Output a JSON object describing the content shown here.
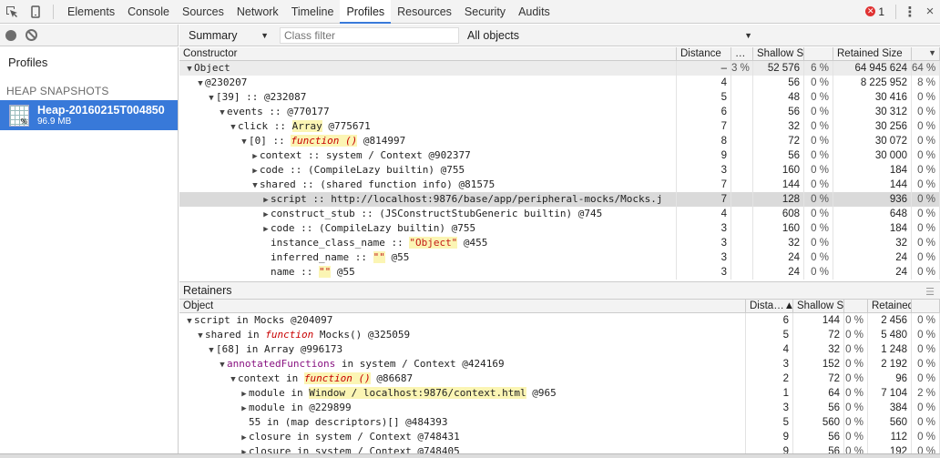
{
  "toolbar": {
    "tabs": [
      "Elements",
      "Console",
      "Sources",
      "Network",
      "Timeline",
      "Profiles",
      "Resources",
      "Security",
      "Audits"
    ],
    "active_tab": "Profiles",
    "error_count": "1",
    "kebab": "⋮",
    "close": "×"
  },
  "sidebar": {
    "title": "Profiles",
    "section": "HEAP SNAPSHOTS",
    "snapshot_name": "Heap-20160215T004850",
    "snapshot_size": "96.9 MB",
    "snapshot_badge": "%"
  },
  "filterbar": {
    "view": "Summary",
    "class_filter_placeholder": "Class filter",
    "objects": "All objects"
  },
  "constructor_grid": {
    "headers": [
      "Constructor",
      "Distance",
      "…",
      "Shallow Size",
      "",
      "Retained Size",
      ""
    ],
    "rows": [
      {
        "indent": 0,
        "tri": "▼",
        "parts": [
          {
            "t": "Object"
          }
        ],
        "dist": "–",
        "obj": "3 %",
        "shallow": "52 576",
        "spct": "6 %",
        "retained": "64 945 624",
        "rpct": "64 %",
        "group": true
      },
      {
        "indent": 1,
        "tri": "▼",
        "parts": [
          {
            "t": "@230207"
          }
        ],
        "dist": "4",
        "obj": "",
        "shallow": "56",
        "spct": "0 %",
        "retained": "8 225 952",
        "rpct": "8 %"
      },
      {
        "indent": 2,
        "tri": "▼",
        "parts": [
          {
            "t": "[39] :: @232087"
          }
        ],
        "dist": "5",
        "obj": "",
        "shallow": "48",
        "spct": "0 %",
        "retained": "30 416",
        "rpct": "0 %"
      },
      {
        "indent": 3,
        "tri": "▼",
        "parts": [
          {
            "t": "events :: @770177"
          }
        ],
        "dist": "6",
        "obj": "",
        "shallow": "56",
        "spct": "0 %",
        "retained": "30 312",
        "rpct": "0 %"
      },
      {
        "indent": 4,
        "tri": "▼",
        "parts": [
          {
            "t": "click :: "
          },
          {
            "t": "Array",
            "c": "hl"
          },
          {
            "t": " @775671"
          }
        ],
        "dist": "7",
        "obj": "",
        "shallow": "32",
        "spct": "0 %",
        "retained": "30 256",
        "rpct": "0 %"
      },
      {
        "indent": 5,
        "tri": "▼",
        "parts": [
          {
            "t": "[0] :: "
          },
          {
            "t": "function ()",
            "c": "hl fn"
          },
          {
            "t": " @814997"
          }
        ],
        "dist": "8",
        "obj": "",
        "shallow": "72",
        "spct": "0 %",
        "retained": "30 072",
        "rpct": "0 %"
      },
      {
        "indent": 6,
        "tri": "▶",
        "parts": [
          {
            "t": "context :: system / Context @902377"
          }
        ],
        "dist": "9",
        "obj": "",
        "shallow": "56",
        "spct": "0 %",
        "retained": "30 000",
        "rpct": "0 %"
      },
      {
        "indent": 6,
        "tri": "▶",
        "parts": [
          {
            "t": "code :: (CompileLazy builtin) @755"
          }
        ],
        "dist": "3",
        "obj": "",
        "shallow": "160",
        "spct": "0 %",
        "retained": "184",
        "rpct": "0 %"
      },
      {
        "indent": 6,
        "tri": "▼",
        "parts": [
          {
            "t": "shared :: (shared function info) @81575"
          }
        ],
        "dist": "7",
        "obj": "",
        "shallow": "144",
        "spct": "0 %",
        "retained": "144",
        "rpct": "0 %"
      },
      {
        "indent": 7,
        "tri": "▶",
        "parts": [
          {
            "t": "script :: http://localhost:9876/base/app/peripheral-mocks/Mocks.j"
          }
        ],
        "dist": "7",
        "obj": "",
        "shallow": "128",
        "spct": "0 %",
        "retained": "936",
        "rpct": "0 %",
        "selected": true
      },
      {
        "indent": 7,
        "tri": "▶",
        "parts": [
          {
            "t": "construct_stub :: (JSConstructStubGeneric builtin) @745"
          }
        ],
        "dist": "4",
        "obj": "",
        "shallow": "608",
        "spct": "0 %",
        "retained": "648",
        "rpct": "0 %"
      },
      {
        "indent": 7,
        "tri": "▶",
        "parts": [
          {
            "t": "code :: (CompileLazy builtin) @755"
          }
        ],
        "dist": "3",
        "obj": "",
        "shallow": "160",
        "spct": "0 %",
        "retained": "184",
        "rpct": "0 %"
      },
      {
        "indent": 7,
        "tri": "",
        "parts": [
          {
            "t": "instance_class_name :: "
          },
          {
            "t": "\"Object\"",
            "c": "hl str"
          },
          {
            "t": " @455"
          }
        ],
        "dist": "3",
        "obj": "",
        "shallow": "32",
        "spct": "0 %",
        "retained": "32",
        "rpct": "0 %"
      },
      {
        "indent": 7,
        "tri": "",
        "parts": [
          {
            "t": "inferred_name :: "
          },
          {
            "t": "\"\"",
            "c": "hl str"
          },
          {
            "t": " @55"
          }
        ],
        "dist": "3",
        "obj": "",
        "shallow": "24",
        "spct": "0 %",
        "retained": "24",
        "rpct": "0 %"
      },
      {
        "indent": 7,
        "tri": "",
        "parts": [
          {
            "t": "name :: "
          },
          {
            "t": "\"\"",
            "c": "hl str"
          },
          {
            "t": " @55"
          }
        ],
        "dist": "3",
        "obj": "",
        "shallow": "24",
        "spct": "0 %",
        "retained": "24",
        "rpct": "0 %"
      }
    ]
  },
  "retainers": {
    "title": "Retainers",
    "handle": "☰",
    "headers": [
      "Object",
      "Dista…▲",
      "Shallow Size",
      "",
      "Retained Size",
      ""
    ],
    "rows": [
      {
        "indent": 0,
        "tri": "▼",
        "parts": [
          {
            "t": "script in Mocks @204097"
          }
        ],
        "dist": "6",
        "shallow": "144",
        "spct": "0 %",
        "retained": "2 456",
        "rpct": "0 %"
      },
      {
        "indent": 1,
        "tri": "▼",
        "parts": [
          {
            "t": "shared in "
          },
          {
            "t": "function",
            "c": "fn"
          },
          {
            "t": " Mocks() @325059"
          }
        ],
        "dist": "5",
        "shallow": "72",
        "spct": "0 %",
        "retained": "5 480",
        "rpct": "0 %"
      },
      {
        "indent": 2,
        "tri": "▼",
        "parts": [
          {
            "t": "[68] in Array @996173"
          }
        ],
        "dist": "4",
        "shallow": "32",
        "spct": "0 %",
        "retained": "1 248",
        "rpct": "0 %"
      },
      {
        "indent": 3,
        "tri": "▼",
        "parts": [
          {
            "t": "annotatedFunctions",
            "c": "prop"
          },
          {
            "t": " in system / Context @424169"
          }
        ],
        "dist": "3",
        "shallow": "152",
        "spct": "0 %",
        "retained": "2 192",
        "rpct": "0 %"
      },
      {
        "indent": 4,
        "tri": "▼",
        "parts": [
          {
            "t": "context in "
          },
          {
            "t": "function ()",
            "c": "hl fn"
          },
          {
            "t": " @86687"
          }
        ],
        "dist": "2",
        "shallow": "72",
        "spct": "0 %",
        "retained": "96",
        "rpct": "0 %"
      },
      {
        "indent": 5,
        "tri": "▶",
        "parts": [
          {
            "t": "module in "
          },
          {
            "t": "Window / localhost:9876/context.html",
            "c": "hl"
          },
          {
            "t": " @965"
          }
        ],
        "dist": "1",
        "shallow": "64",
        "spct": "0 %",
        "retained": "7 104",
        "rpct": "2 %"
      },
      {
        "indent": 5,
        "tri": "▶",
        "parts": [
          {
            "t": "module in @229899"
          }
        ],
        "dist": "3",
        "shallow": "56",
        "spct": "0 %",
        "retained": "384",
        "rpct": "0 %"
      },
      {
        "indent": 5,
        "tri": "",
        "parts": [
          {
            "t": "55 in (map descriptors)[] @484393"
          }
        ],
        "dist": "5",
        "shallow": "560",
        "spct": "0 %",
        "retained": "560",
        "rpct": "0 %"
      },
      {
        "indent": 5,
        "tri": "▶",
        "parts": [
          {
            "t": "closure in system / Context @748431"
          }
        ],
        "dist": "9",
        "shallow": "56",
        "spct": "0 %",
        "retained": "112",
        "rpct": "0 %"
      },
      {
        "indent": 5,
        "tri": "▶",
        "parts": [
          {
            "t": "closure in system / Context @748405"
          }
        ],
        "dist": "9",
        "shallow": "56",
        "spct": "0 %",
        "retained": "192",
        "rpct": "0 %"
      }
    ]
  },
  "colors": {
    "accent": "#3879d9",
    "error": "#e03232",
    "highlight": "#fbf5b4",
    "function": "#c80000"
  }
}
